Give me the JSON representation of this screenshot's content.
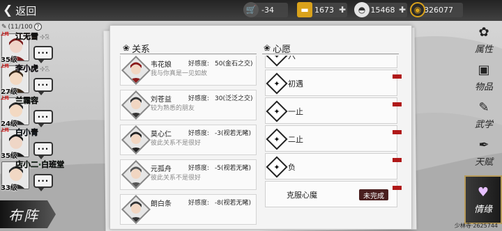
{
  "topbar": {
    "back_label": "返回",
    "resources": [
      {
        "icon": "cart-icon",
        "value": "-34"
      },
      {
        "icon": "gold-bar-icon",
        "value": "1673"
      },
      {
        "icon": "silver-ingot-icon",
        "value": "15468"
      },
      {
        "icon": "coin-icon",
        "value": "326077"
      }
    ]
  },
  "party": {
    "count_label": "(11/100",
    "members": [
      {
        "tag": "上阵",
        "name": "江无雪",
        "bonus": "+2",
        "level": "35级",
        "name_color": "#c05a2a"
      },
      {
        "tag": "上阵",
        "name": "李小虎",
        "bonus": "+1",
        "level": "27级",
        "name_color": "#9b4bd1"
      },
      {
        "tag": "上阵",
        "name": "兰霜容",
        "bonus": "",
        "level": "24级",
        "name_color": "#2a8f3a"
      },
      {
        "tag": "上阵",
        "name": "白小青",
        "bonus": "",
        "level": "35级",
        "name_color": "#2a7bd1"
      },
      {
        "tag": "",
        "name": "店小二·白班堂",
        "bonus": "",
        "level": "33级",
        "name_color": "#2a8f3a"
      }
    ],
    "chat_glyph": "···",
    "formation_label": "布阵"
  },
  "relations": {
    "title": "关系",
    "fav_label": "好感度:",
    "items": [
      {
        "name": "韦花娘",
        "fav": "50(金石之交)",
        "desc": "我与你真是一见如故"
      },
      {
        "name": "刘苍益",
        "fav": "30(泛泛之交)",
        "desc": "较为熟悉的朋友"
      },
      {
        "name": "莫心仁",
        "fav": "-3(视若无睹)",
        "desc": "彼此关系不是很好"
      },
      {
        "name": "元孤舟",
        "fav": "-5(视若无睹)",
        "desc": "彼此关系不是很好"
      },
      {
        "name": "朗白条",
        "fav": "-8(视若无睹)",
        "desc": ""
      }
    ]
  },
  "wishes": {
    "title": "心愿",
    "items": [
      {
        "label": "六",
        "status": ""
      },
      {
        "label": "初遇",
        "status": ""
      },
      {
        "label": "一止",
        "status": ""
      },
      {
        "label": "二止",
        "status": ""
      },
      {
        "label": "负",
        "status": ""
      },
      {
        "label": "克服心魔",
        "status": "未完成"
      }
    ]
  },
  "rightmenu": {
    "items": [
      {
        "icon": "flower-icon",
        "label": "属性"
      },
      {
        "icon": "box-icon",
        "label": "物品"
      },
      {
        "icon": "book-icon",
        "label": "武学"
      },
      {
        "icon": "feather-icon",
        "label": "天赋"
      },
      {
        "icon": "heart-icon",
        "label": "情缘"
      }
    ]
  },
  "watermark": "少林寺·2625744",
  "colors": {
    "accent_red": "#b01818",
    "status_bg": "#4a1f1f"
  }
}
